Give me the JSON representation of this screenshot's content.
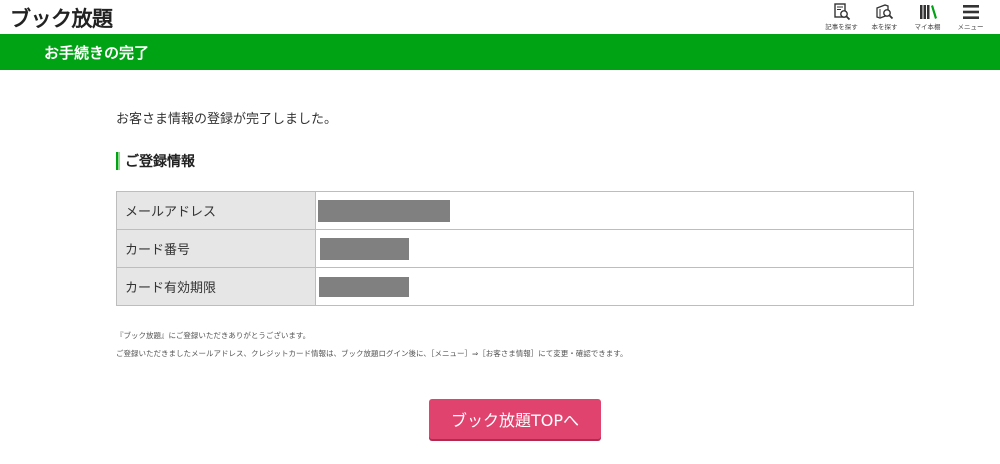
{
  "header": {
    "logo": "ブック放題",
    "nav": [
      {
        "label": "記事を探す",
        "icon": "article-search-icon"
      },
      {
        "label": "本を探す",
        "icon": "book-search-icon"
      },
      {
        "label": "マイ本棚",
        "icon": "bookshelf-icon"
      },
      {
        "label": "メニュー",
        "icon": "hamburger-menu-icon"
      }
    ]
  },
  "title_bar": {
    "title": "お手続きの完了"
  },
  "main": {
    "complete_message": "お客さま情報の登録が完了しました。",
    "section_title": "ご登録情報",
    "table": [
      {
        "label": "メールアドレス",
        "value_masked": true
      },
      {
        "label": "カード番号",
        "value_masked": true
      },
      {
        "label": "カード有効期限",
        "value_masked": true
      }
    ],
    "notes": [
      "『ブック放題』にご登録いただきありがとうございます。",
      "ご登録いただきましたメールアドレス、クレジットカード情報は、ブック放題ログイン後に、［メニュー］⇒［お客さま情報］にて変更・確認できます。"
    ],
    "top_button": "ブック放題TOPへ"
  },
  "colors": {
    "brand_green": "#00a314",
    "button_pink": "#e0436e",
    "table_header_bg": "#e6e6e6",
    "mask_gray": "#808080"
  }
}
